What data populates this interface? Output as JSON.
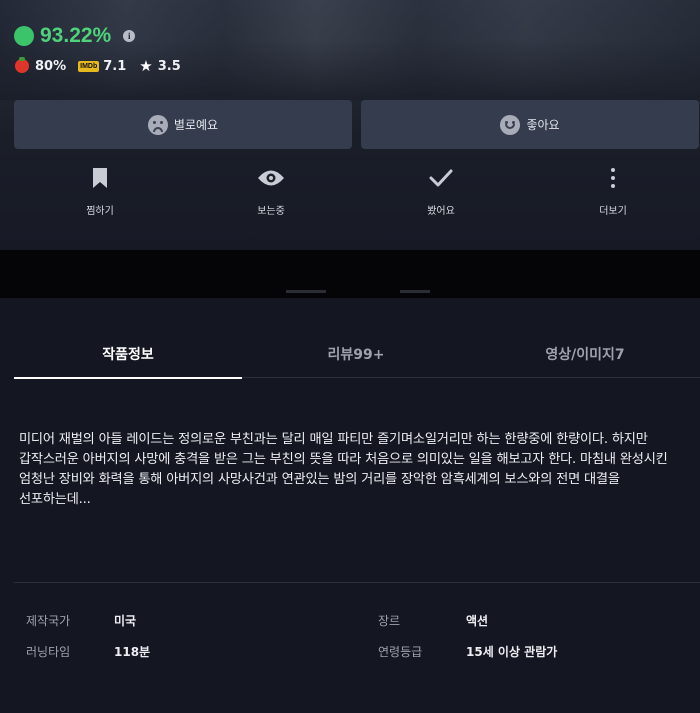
{
  "header": {
    "score": "93.22%",
    "score_color": "#4ed27a",
    "ratings": {
      "tomato": "80%",
      "imdb_badge": "IMDb",
      "imdb": "7.1",
      "star": "3.5"
    }
  },
  "votes": {
    "dislike_label": "별로예요",
    "like_label": "좋아요"
  },
  "actions": [
    {
      "label": "찜하기",
      "icon": "bookmark-icon"
    },
    {
      "label": "보는중",
      "icon": "eye-icon"
    },
    {
      "label": "봤어요",
      "icon": "check-icon"
    },
    {
      "label": "더보기",
      "icon": "more-vertical-icon"
    }
  ],
  "tabs": [
    {
      "label": "작품정보",
      "active": true
    },
    {
      "label": "리뷰99+",
      "active": false
    },
    {
      "label": "영상/이미지7",
      "active": false
    }
  ],
  "synopsis": "미디어 재벌의 아들 레이드는 정의로운 부친과는 달리 매일 파티만 즐기며소일거리만 하는 한량중에 한량이다. 하지만 갑작스러운 아버지의 사망에 충격을 받은 그는 부친의 뜻을 따라 처음으로 의미있는 일을 해보고자 한다. 마침내 완성시킨 엄청난 장비와 화력을 통해 아버지의 사망사건과 연관있는 밤의 거리를 장악한 암흑세계의 보스와의 전면 대결을 선포하는데...",
  "details": {
    "country_label": "제작국가",
    "country": "미국",
    "runtime_label": "러닝타임",
    "runtime": "118분",
    "genre_label": "장르",
    "genre": "액션",
    "rating_label": "연령등급",
    "rating": "15세 이상 관람가"
  }
}
